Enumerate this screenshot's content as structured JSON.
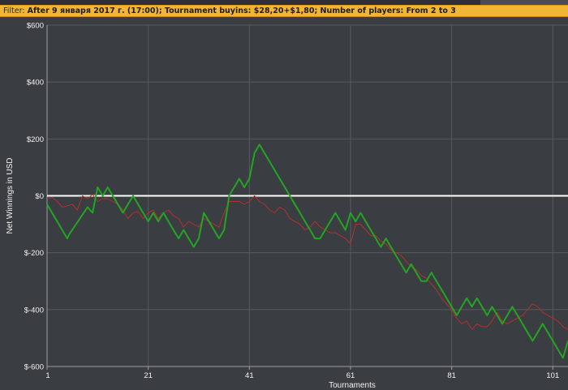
{
  "filter": {
    "label": "Filter:",
    "text": "After 9 января 2017 г. (17:00); Tournament buyins: $28,20+$1,80; Number of players: From 2 to 3"
  },
  "chart_data": {
    "type": "line",
    "xlabel": "Tournaments",
    "ylabel": "Net Winnings in USD",
    "xlim": [
      1,
      104
    ],
    "ylim": [
      -600,
      600
    ],
    "x_ticks": [
      1,
      21,
      41,
      61,
      81,
      101
    ],
    "y_ticks": [
      600,
      400,
      200,
      0,
      -200,
      -400,
      -600
    ],
    "y_tick_labels": [
      "$600",
      "$400",
      "$200",
      "$0",
      "$-200",
      "$-400",
      "$-600"
    ],
    "grid": true,
    "zero_line": true,
    "colors": {
      "background": "#3a3d42",
      "grid": "#575b61",
      "zero_line": "#ffffff",
      "series_1": "#22a522",
      "series_2": "#b5302a"
    },
    "series": [
      {
        "x": [
          1,
          5,
          5.4,
          9,
          10,
          11,
          12,
          13,
          14,
          15,
          16,
          17,
          18,
          19,
          20,
          21,
          22,
          23,
          24,
          25,
          26,
          27,
          28,
          29,
          30,
          31,
          32,
          33,
          34,
          35,
          36,
          37,
          38,
          39,
          40,
          41,
          42,
          43,
          44,
          45,
          46,
          47,
          48,
          49,
          50,
          51,
          52,
          53,
          54,
          55,
          56,
          57,
          58,
          59,
          60,
          61,
          62,
          63,
          64,
          65,
          66,
          67,
          68,
          69,
          70,
          71,
          72,
          73,
          74,
          75,
          76,
          77,
          78,
          79,
          80,
          81,
          82,
          83,
          84,
          85,
          86,
          87,
          88,
          89,
          90,
          91,
          92,
          93,
          94,
          95,
          96,
          97,
          98,
          99,
          100,
          101,
          102,
          103,
          104
        ],
        "values": [
          -30,
          -150,
          -135,
          -40,
          -60,
          30,
          0,
          30,
          0,
          -30,
          -60,
          -30,
          0,
          -30,
          -60,
          -90,
          -60,
          -90,
          -60,
          -90,
          -120,
          -150,
          -120,
          -150,
          -180,
          -150,
          -60,
          -90,
          -120,
          -150,
          -120,
          0,
          30,
          60,
          30,
          60,
          150,
          180,
          150,
          120,
          90,
          60,
          30,
          0,
          -30,
          -60,
          -90,
          -120,
          -150,
          -150,
          -120,
          -90,
          -60,
          -90,
          -120,
          -60,
          -90,
          -60,
          -90,
          -120,
          -150,
          -180,
          -150,
          -180,
          -210,
          -240,
          -270,
          -240,
          -270,
          -300,
          -300,
          -270,
          -300,
          -330,
          -360,
          -390,
          -420,
          -390,
          -360,
          -390,
          -360,
          -390,
          -420,
          -390,
          -420,
          -450,
          -420,
          -390,
          -420,
          -450,
          -480,
          -510,
          -480,
          -450,
          -480,
          -510,
          -540,
          -570,
          -510
        ]
      },
      {
        "x": [
          1,
          2,
          3,
          4,
          5,
          6,
          7,
          8,
          9,
          10,
          11,
          12,
          13,
          14,
          15,
          16,
          17,
          18,
          19,
          20,
          21,
          22,
          23,
          24,
          25,
          26,
          27,
          28,
          29,
          30,
          31,
          32,
          33,
          34,
          35,
          36,
          37,
          38,
          39,
          40,
          41,
          42,
          43,
          44,
          45,
          46,
          47,
          48,
          49,
          50,
          51,
          52,
          53,
          54,
          55,
          56,
          57,
          58,
          59,
          60,
          61,
          62,
          63,
          64,
          65,
          66,
          67,
          68,
          69,
          70,
          71,
          72,
          73,
          74,
          75,
          76,
          77,
          78,
          79,
          80,
          81,
          82,
          83,
          84,
          85,
          86,
          87,
          88,
          89,
          90,
          91,
          92,
          93,
          94,
          95,
          96,
          97,
          98,
          99,
          100,
          101,
          102,
          103,
          104
        ],
        "values": [
          -10,
          -5,
          -20,
          -40,
          -35,
          -30,
          -50,
          0,
          -10,
          5,
          -20,
          -10,
          -10,
          -20,
          -30,
          -50,
          -80,
          -60,
          -55,
          -80,
          -60,
          -50,
          -80,
          -60,
          -50,
          -70,
          -80,
          -110,
          -90,
          -100,
          -110,
          -80,
          -90,
          -100,
          -110,
          -60,
          -20,
          -20,
          -20,
          -30,
          -20,
          0,
          -20,
          -30,
          -50,
          -60,
          -40,
          -50,
          -80,
          -90,
          -100,
          -120,
          -110,
          -90,
          -110,
          -120,
          -130,
          -130,
          -140,
          -150,
          -170,
          -100,
          -100,
          -120,
          -140,
          -140,
          -160,
          -170,
          -190,
          -200,
          -210,
          -230,
          -250,
          -260,
          -280,
          -290,
          -310,
          -330,
          -360,
          -380,
          -400,
          -430,
          -450,
          -440,
          -470,
          -450,
          -460,
          -460,
          -440,
          -410,
          -440,
          -450,
          -440,
          -430,
          -420,
          -400,
          -380,
          -390,
          -410,
          -420,
          -430,
          -440,
          -460,
          -470
        ]
      }
    ]
  }
}
